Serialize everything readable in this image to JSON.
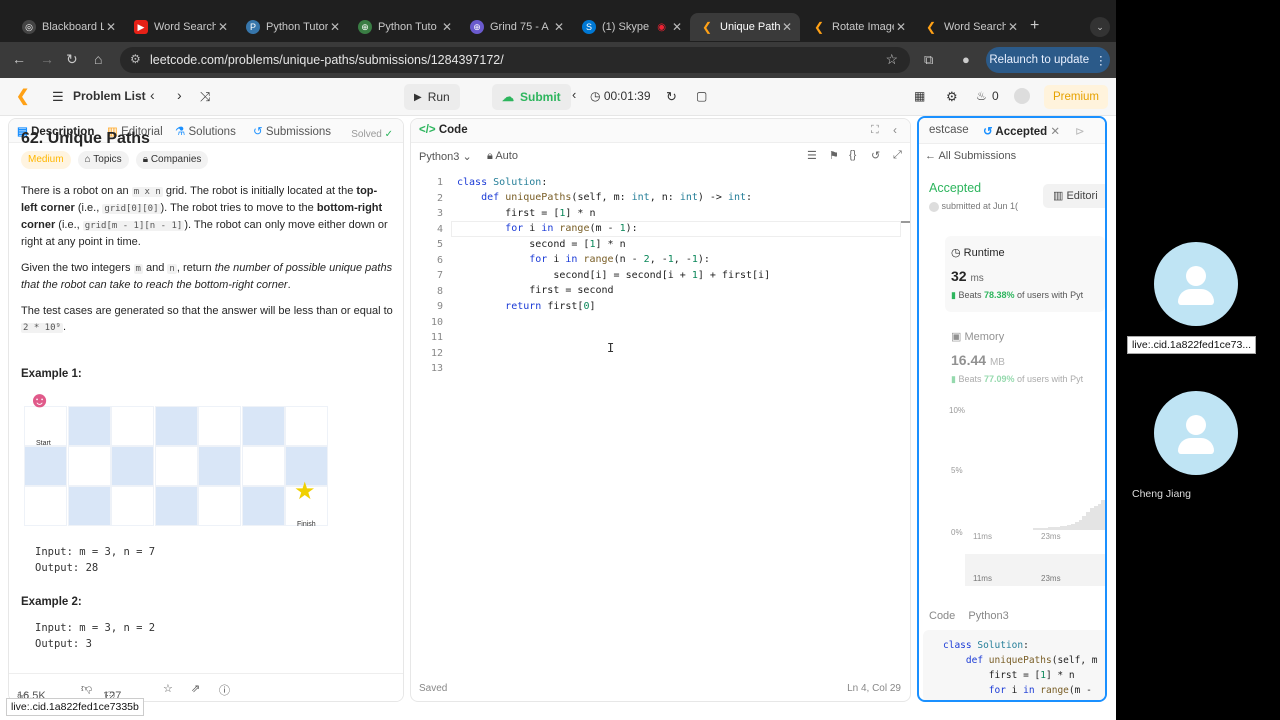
{
  "tabs": [
    {
      "title": "Blackboard L",
      "color": "#444"
    },
    {
      "title": "Word Search",
      "color": "#e62117"
    },
    {
      "title": "Python Tutor",
      "color": "#3776ab"
    },
    {
      "title": "Python Tuto",
      "color": "#3a7d44"
    },
    {
      "title": "Grind 75 - A",
      "color": "#6a5acd"
    },
    {
      "title": "(1) Skype",
      "color": "#0078d4"
    },
    {
      "title": "Unique Path",
      "color": "#ffa116"
    },
    {
      "title": "Rotate Image",
      "color": "#ffa116"
    },
    {
      "title": "Word Search",
      "color": "#ffa116"
    }
  ],
  "address": {
    "url": "leetcode.com/problems/unique-paths/submissions/1284397172/",
    "relaunch": "Relaunch to update"
  },
  "toolbar": {
    "problem_list": "Problem List",
    "run": "Run",
    "submit": "Submit",
    "timer": "00:01:39",
    "streak": "0",
    "premium": "Premium"
  },
  "left": {
    "tabs": [
      "Description",
      "Editorial",
      "Solutions",
      "Submissions"
    ],
    "title": "62. Unique Paths",
    "solved": "Solved",
    "tags": [
      "Medium",
      "Topics",
      "Companies"
    ],
    "p1a": "There is a robot on an ",
    "p1_mxn": "m x n",
    "p1b": " grid. The robot is initially located at the ",
    "p1_tl": "top-left corner",
    "p1c": " (i.e., ",
    "p1_g00": "grid[0][0]",
    "p1d": "). The robot tries to move to the ",
    "p1_br": "bottom-right corner",
    "p1e": " (i.e., ",
    "p1_gmn": "grid[m - 1][n - 1]",
    "p1f": "). The robot can only move either down or right at any point in time.",
    "p2a": "Given the two integers ",
    "p2_m": "m",
    "p2b": " and ",
    "p2_n": "n",
    "p2c": ", return ",
    "p2_it": "the number of possible unique paths that the robot can take to reach the bottom-right corner",
    "p2d": ".",
    "p3a": "The test cases are generated so that the answer will be less than or equal to ",
    "p3_code": "2 * 10⁹",
    "p3b": ".",
    "ex1": "Example 1:",
    "start": "Start",
    "finish": "Finish",
    "ex1_in": "Input: m = 3, n = 7",
    "ex1_out": "Output: 28",
    "ex2": "Example 2:",
    "ex2_in": "Input: m = 3, n = 2",
    "ex2_out": "Output: 3",
    "likes": "16.5K",
    "comments": "127"
  },
  "code": {
    "title": "Code",
    "lang": "Python3",
    "auto": "Auto",
    "saved": "Saved",
    "cursor": "Ln 4, Col 29",
    "lines": [
      "1",
      "2",
      "3",
      "4",
      "5",
      "6",
      "7",
      "8",
      "9",
      "10",
      "11",
      "12",
      "13"
    ]
  },
  "right": {
    "tab_testcase": "estcase",
    "tab_accepted": "Accepted",
    "all_subs": "All Submissions",
    "status": "Accepted",
    "editorial": "Editori",
    "submitted": "submitted at Jun 1(",
    "runtime_label": "Runtime",
    "runtime_value": "32",
    "runtime_unit": "ms",
    "beats_rt_pre": "Beats",
    "beats_rt_pct": "78.38%",
    "beats_rt_post": "of users with Pyt",
    "memory_label": "Memory",
    "memory_value": "16.44",
    "memory_unit": "MB",
    "beats_mem_pre": "Beats",
    "beats_mem_pct": "77.09%",
    "beats_mem_post": "of users with Pyt",
    "pct10": "10%",
    "pct5": "5%",
    "pct0": "0%",
    "x11": "11ms",
    "x23": "23ms",
    "code_label": "Code",
    "code_lang": "Python3"
  },
  "participants": {
    "tooltip1": "live:.cid.1a822fed1ce73...",
    "name2": "Cheng Jiang",
    "statusbar": "live:.cid.1a822fed1ce7335b"
  }
}
